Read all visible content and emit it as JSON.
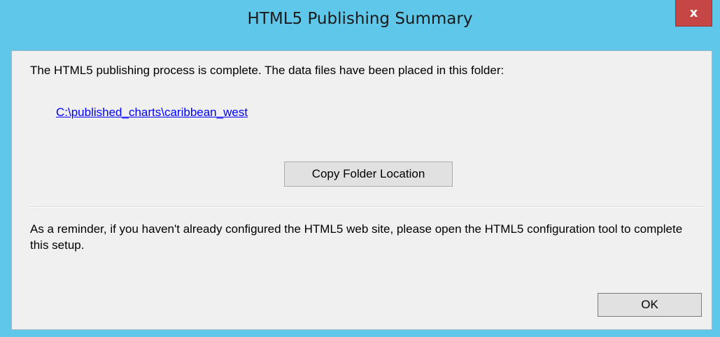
{
  "window": {
    "title": "HTML5 Publishing Summary",
    "close_glyph": "x"
  },
  "content": {
    "complete_message": "The HTML5 publishing process is complete. The data files have been placed in this folder:",
    "folder_path": "C:\\published_charts\\caribbean_west",
    "copy_button_label": "Copy Folder Location",
    "reminder_text": "As a reminder, if you haven't already configured the HTML5 web site, please open the HTML5 configuration tool to complete this setup.",
    "ok_button_label": "OK"
  },
  "colors": {
    "titlebar": "#5fc7ea",
    "close_button": "#c64545",
    "link": "#0000ff",
    "client_background": "#f0f0f0"
  },
  "icons": {
    "close": "close-icon"
  }
}
